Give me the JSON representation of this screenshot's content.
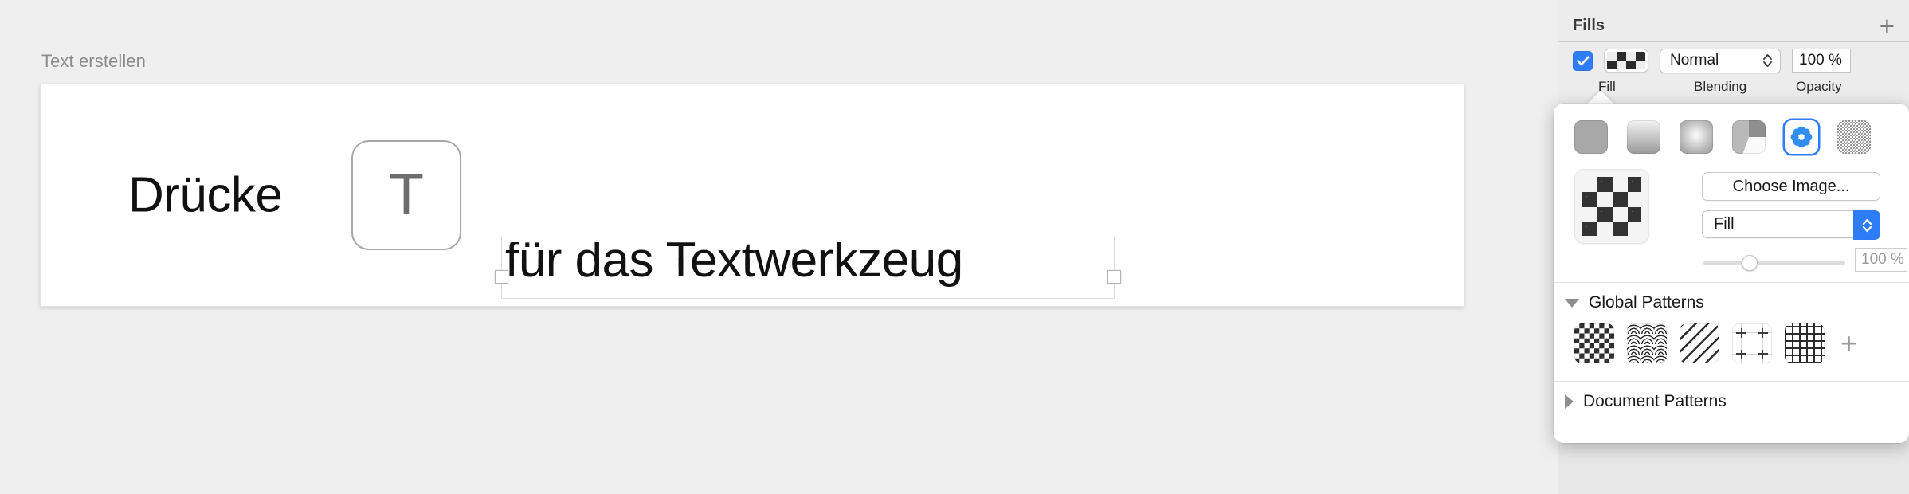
{
  "canvas": {
    "hint_label": "Text erstellen",
    "instruction_word": "Drücke",
    "key_label": "T",
    "text_object_value": "für das Textwerkzeug"
  },
  "inspector": {
    "section_title": "Fills",
    "add_fill_icon": "plus-icon",
    "fill_enabled_icon": "checkmark-icon",
    "fill_swatch_icon": "checkerboard-swatch-icon",
    "blending_value": "Normal",
    "opacity_value": "100 %",
    "labels": {
      "fill": "Fill",
      "blending": "Blending",
      "opacity": "Opacity"
    }
  },
  "popover": {
    "fill_types": [
      {
        "name": "solid-fill-type",
        "selected": false
      },
      {
        "name": "linear-gradient-fill-type",
        "selected": false
      },
      {
        "name": "radial-gradient-fill-type",
        "selected": false
      },
      {
        "name": "conic-gradient-fill-type",
        "selected": false
      },
      {
        "name": "image-fill-type",
        "selected": true
      },
      {
        "name": "noise-fill-type",
        "selected": false
      }
    ],
    "preview_icon": "checkerboard-pattern-preview",
    "choose_image_label": "Choose Image...",
    "mode_value": "Fill",
    "pattern_opacity_value": "100 %",
    "global_patterns": {
      "title": "Global Patterns",
      "expanded": true,
      "items": [
        {
          "name": "pattern-checkerboard"
        },
        {
          "name": "pattern-waves"
        },
        {
          "name": "pattern-diagonal-stripes"
        },
        {
          "name": "pattern-crosses-guides"
        },
        {
          "name": "pattern-plaid-grid"
        }
      ],
      "add_icon": "plus-icon"
    },
    "document_patterns": {
      "title": "Document Patterns",
      "expanded": false
    }
  },
  "colors": {
    "accent": "#2f7df6",
    "panel_bg": "#ececec",
    "canvas_bg": "#f0efef",
    "text_primary": "#1a1a1a",
    "text_muted": "#8c8c8c"
  }
}
